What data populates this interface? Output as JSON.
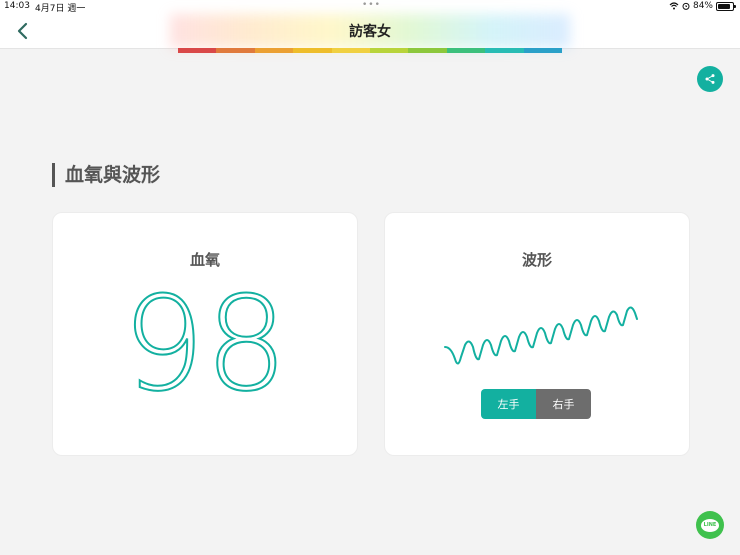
{
  "status_bar": {
    "time": "14:03",
    "date": "4月7日 週一",
    "battery": "84%",
    "battery_level": 0.84
  },
  "header": {
    "title": "訪客女",
    "strip_colors": [
      "#d94848",
      "#e07a3c",
      "#eba032",
      "#eebd2a",
      "#f0d040",
      "#b8d43a",
      "#8cc83c",
      "#3cc07c",
      "#28bcb4",
      "#2aa0c8"
    ]
  },
  "section": {
    "title": "血氧與波形"
  },
  "oxygen_card": {
    "title": "血氧",
    "value": "98"
  },
  "wave_card": {
    "title": "波形",
    "left_label": "左手",
    "right_label": "右手"
  },
  "line_button": {
    "label": "LINE"
  },
  "colors": {
    "accent": "#13b0a0",
    "inactive": "#6d6d6d",
    "line_green": "#3fc14d"
  }
}
